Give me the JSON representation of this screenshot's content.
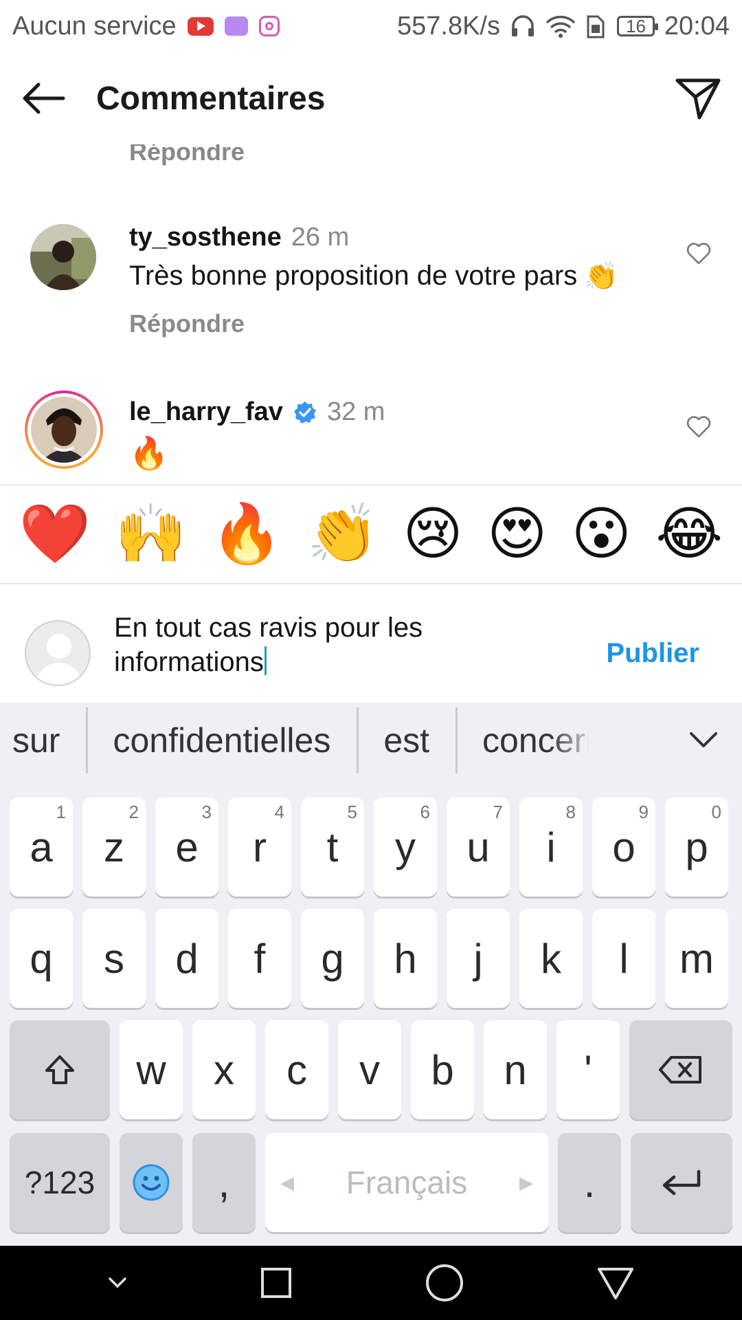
{
  "status_bar": {
    "carrier": "Aucun service",
    "network_speed": "557.8K/s",
    "battery": "16",
    "time": "20:04"
  },
  "header": {
    "title": "Commentaires"
  },
  "comments": {
    "partial_reply_label": "Répondre",
    "items": [
      {
        "username": "ty_sosthene",
        "time": "26 m",
        "text": "Très bonne proposition de votre pars",
        "text_emoji": "👏",
        "reply_label": "Répondre"
      },
      {
        "username": "le_harry_fav",
        "time": "32 m",
        "text": "🔥",
        "verified": true
      }
    ]
  },
  "emoji_bar": [
    "❤️",
    "🙌",
    "🔥",
    "👏",
    "😢",
    "😍",
    "😮",
    "😂"
  ],
  "composer": {
    "text_line1": "En tout cas ravis pour les",
    "text_line2": "informations",
    "publish_label": "Publier"
  },
  "keyboard": {
    "suggestions": [
      "sur",
      "confidentielles",
      "est",
      "concern"
    ],
    "row1": [
      {
        "k": "a",
        "n": "1"
      },
      {
        "k": "z",
        "n": "2"
      },
      {
        "k": "e",
        "n": "3"
      },
      {
        "k": "r",
        "n": "4"
      },
      {
        "k": "t",
        "n": "5"
      },
      {
        "k": "y",
        "n": "6"
      },
      {
        "k": "u",
        "n": "7"
      },
      {
        "k": "i",
        "n": "8"
      },
      {
        "k": "o",
        "n": "9"
      },
      {
        "k": "p",
        "n": "0"
      }
    ],
    "row2": [
      "q",
      "s",
      "d",
      "f",
      "g",
      "h",
      "j",
      "k",
      "l",
      "m"
    ],
    "row3": [
      "w",
      "x",
      "c",
      "v",
      "b",
      "n",
      "'"
    ],
    "symbols_label": "?123",
    "comma": ",",
    "space_label": "Français",
    "period": "."
  },
  "colors": {
    "accent_blue": "#1c95e6",
    "verified_blue": "#3897f0",
    "story_ring": [
      "#f9a43a",
      "#d6249f"
    ]
  }
}
